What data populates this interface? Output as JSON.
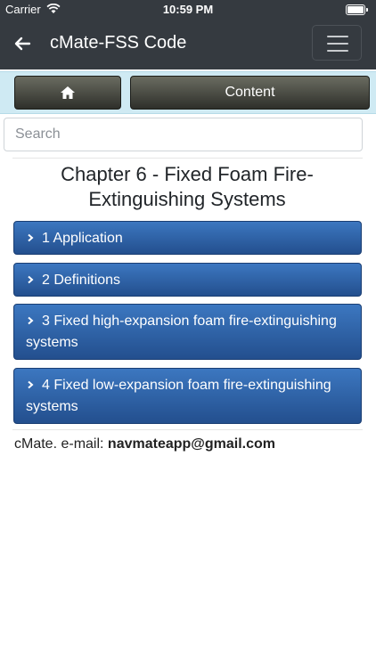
{
  "status_bar": {
    "carrier": "Carrier",
    "time": "10:59 PM"
  },
  "header": {
    "title": "cMate-FSS Code"
  },
  "toolbar": {
    "content_label": "Content"
  },
  "search": {
    "placeholder": "Search"
  },
  "chapter": {
    "title": "Chapter 6 - Fixed Foam Fire-Extinguishing Systems"
  },
  "sections": [
    {
      "label": "1 Application"
    },
    {
      "label": "2 Definitions"
    },
    {
      "label": "3 Fixed high-expansion foam fire-extinguishing systems"
    },
    {
      "label": "4 Fixed low-expansion foam fire-extinguishing systems"
    }
  ],
  "footer": {
    "prefix": "cMate. e-mail: ",
    "email": "navmateapp@gmail.com"
  },
  "colors": {
    "navbar": "#353a40",
    "toolbar": "#cfeaf3",
    "section_button": "#2d62aa"
  }
}
